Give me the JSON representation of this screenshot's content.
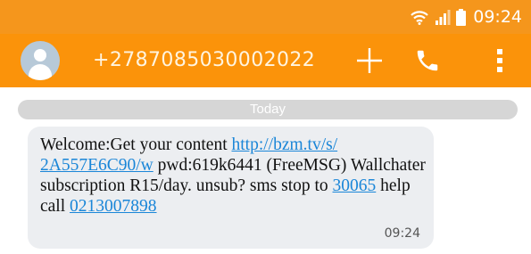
{
  "status_bar": {
    "time": "09:24",
    "icons": [
      "wifi-icon",
      "signal-icon",
      "battery-icon"
    ]
  },
  "header": {
    "contact": "+2787085030002022",
    "actions": [
      "add-icon",
      "phone-icon",
      "more-vert-icon"
    ]
  },
  "conversation": {
    "date_divider": "Today",
    "message": {
      "part1": "Welcome:Get your content ",
      "link_url_line1": "http://bzm.tv/s/",
      "link_url_line2": "2A557E6C90/w",
      "part2": " pwd:619k6441 (FreeMSG) Wallchater subscription R15/day. unsub? sms stop to ",
      "link_short_code": "30065",
      "part3": " help call ",
      "link_phone": "0213007898",
      "time": "09:24"
    }
  },
  "colors": {
    "status_bar": "#f5961c",
    "app_bar": "#fb930a",
    "bubble": "#eceef1",
    "link": "#1a86d8",
    "divider": "#d6d6d6"
  }
}
